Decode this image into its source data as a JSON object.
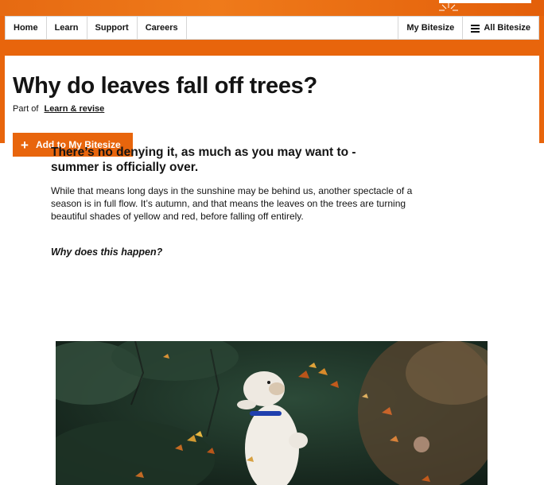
{
  "nav": {
    "items": [
      "Home",
      "Learn",
      "Support",
      "Careers"
    ],
    "my_bitesize": "My Bitesize",
    "all_bitesize": "All Bitesize"
  },
  "page": {
    "title": "Why do leaves fall off trees?",
    "part_of_label": "Part of",
    "part_of_link": "Learn & revise",
    "add_button": "Add to My Bitesize"
  },
  "article": {
    "lead": "There’s no denying it, as much as you may want to - summer is officially over.",
    "body": "While that means long days in the sunshine may be behind us, another spectacle of a season is in full flow. It’s autumn, and that means the leaves on the trees are turning beautiful shades of yellow and red, before falling off entirely.",
    "subhead": "Why does this happen?"
  },
  "colors": {
    "brand_orange": "#e8650c",
    "text": "#141414"
  },
  "icons": {
    "menu": "hamburger-menu-icon",
    "add": "plus-icon"
  }
}
